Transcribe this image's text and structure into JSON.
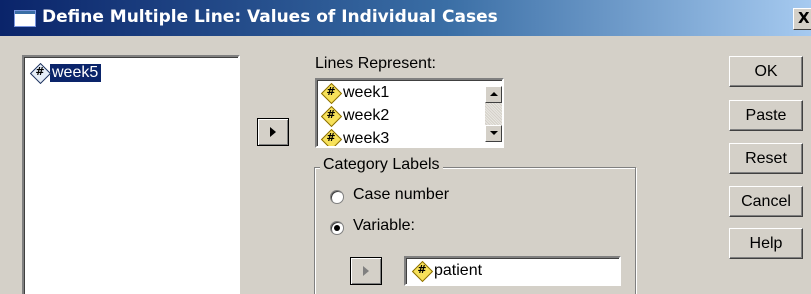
{
  "window": {
    "title": "Define Multiple Line: Values of Individual Cases",
    "close_glyph": "X",
    "title_gradient_start": "#0a246a",
    "face_color": "#d4d0c8",
    "selection_color": "#0a246a"
  },
  "source_list": {
    "items": [
      {
        "label": "week5",
        "icon": "numeric-variable-icon",
        "selected": true
      }
    ]
  },
  "lines_represent": {
    "label": "Lines Represent:",
    "items": [
      {
        "label": "week1",
        "icon": "numeric-variable-icon"
      },
      {
        "label": "week2",
        "icon": "numeric-variable-icon"
      },
      {
        "label": "week3",
        "icon": "numeric-variable-icon"
      }
    ]
  },
  "category_labels": {
    "legend": "Category Labels",
    "options": [
      {
        "label": "Case number",
        "checked": false
      },
      {
        "label": "Variable:",
        "checked": true
      }
    ],
    "variable": {
      "label": "patient",
      "icon": "numeric-variable-icon"
    }
  },
  "buttons": {
    "ok": "OK",
    "paste": "Paste",
    "reset": "Reset",
    "cancel": "Cancel",
    "help": "Help"
  },
  "icons": {
    "move_right": "right-arrow-icon",
    "scroll_up": "scroll-up-icon",
    "scroll_down": "scroll-down-icon"
  }
}
